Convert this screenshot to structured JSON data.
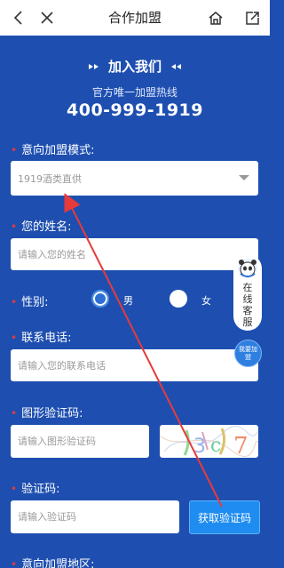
{
  "topbar": {
    "title": "合作加盟"
  },
  "hero": {
    "title": "加入我们",
    "subtitle": "官方唯一加盟热线",
    "phone": "400-999-1919"
  },
  "form": {
    "mode": {
      "label": "意向加盟模式:",
      "value": "1919酒类直供"
    },
    "name": {
      "label": "您的姓名:",
      "placeholder": "请输入您的姓名"
    },
    "gender": {
      "label": "性别:",
      "options": [
        "男",
        "女"
      ],
      "selected": "男"
    },
    "phone": {
      "label": "联系电话:",
      "placeholder": "请输入您的联系电话"
    },
    "captcha": {
      "label": "图形验证码:",
      "placeholder": "请输入图形验证码",
      "image_text": "3c7"
    },
    "sms": {
      "label": "验证码:",
      "placeholder": "请输入验证码",
      "button": "获取验证码"
    },
    "region": {
      "label": "意向加盟地区:"
    }
  },
  "floating": {
    "customer_service": "在线客服",
    "join": "我要加盟"
  },
  "colors": {
    "background": "#1e4fb0",
    "required_star": "#e23b3b",
    "button": "#1e8cf0",
    "annotation": "#e83a3a"
  }
}
